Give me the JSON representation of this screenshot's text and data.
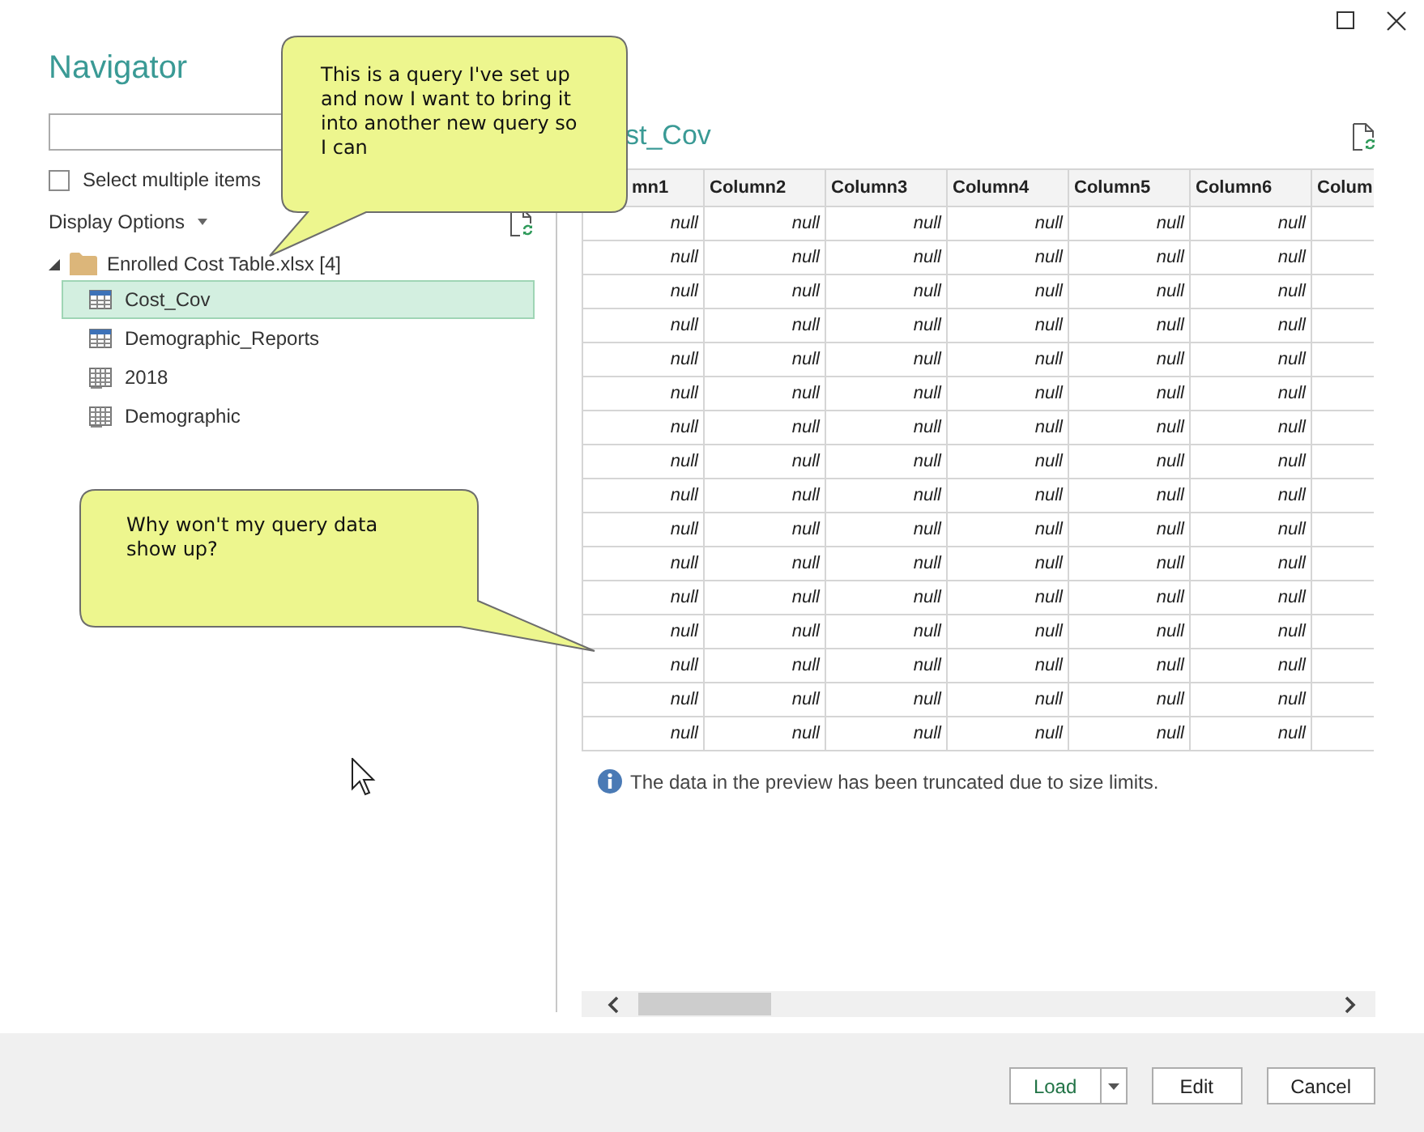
{
  "navigator": {
    "title": "Navigator",
    "select_multiple": {
      "label": "Select multiple items",
      "checked": false
    },
    "display_options": "Display Options",
    "tree": [
      {
        "label": "Enrolled Cost Table.xlsx [4]",
        "expanded": true,
        "children": [
          {
            "label": "Cost_Cov",
            "kind": "table",
            "selected": true
          },
          {
            "label": "Demographic_Reports",
            "kind": "table",
            "selected": false
          },
          {
            "label": "2018",
            "kind": "sheet",
            "selected": false
          },
          {
            "label": "Demographic",
            "kind": "sheet",
            "selected": false
          }
        ]
      }
    ]
  },
  "preview": {
    "title": "st_Cov",
    "columns": [
      "mn1",
      "Column2",
      "Column3",
      "Column4",
      "Column5",
      "Column6",
      "Colum"
    ],
    "rows": [
      [
        "null",
        "null",
        "null",
        "null",
        "null",
        "null"
      ],
      [
        "null",
        "null",
        "null",
        "null",
        "null",
        "null"
      ],
      [
        "null",
        "null",
        "null",
        "null",
        "null",
        "null"
      ],
      [
        "null",
        "null",
        "null",
        "null",
        "null",
        "null"
      ],
      [
        "null",
        "null",
        "null",
        "null",
        "null",
        "null"
      ],
      [
        "null",
        "null",
        "null",
        "null",
        "null",
        "null"
      ],
      [
        "null",
        "null",
        "null",
        "null",
        "null",
        "null"
      ],
      [
        "null",
        "null",
        "null",
        "null",
        "null",
        "null"
      ],
      [
        "null",
        "null",
        "null",
        "null",
        "null",
        "null"
      ],
      [
        "null",
        "null",
        "null",
        "null",
        "null",
        "null"
      ],
      [
        "null",
        "null",
        "null",
        "null",
        "null",
        "null"
      ],
      [
        "null",
        "null",
        "null",
        "null",
        "null",
        "null"
      ],
      [
        "null",
        "null",
        "null",
        "null",
        "null",
        "null"
      ],
      [
        "null",
        "null",
        "null",
        "null",
        "null",
        "null"
      ],
      [
        "null",
        "null",
        "null",
        "null",
        "null",
        "null"
      ],
      [
        "null",
        "null",
        "null",
        "null",
        "null",
        "null"
      ]
    ],
    "notice": "The data in the preview has been truncated due to size limits."
  },
  "buttons": [
    {
      "label": "Load",
      "kind": "split"
    },
    {
      "label": "Edit",
      "kind": "plain"
    },
    {
      "label": "Cancel",
      "kind": "plain"
    }
  ],
  "callouts": [
    {
      "text": "This is a query I've set up and now I want to bring it into another new query so I can"
    },
    {
      "text": "Why won't my query data show up?"
    }
  ]
}
